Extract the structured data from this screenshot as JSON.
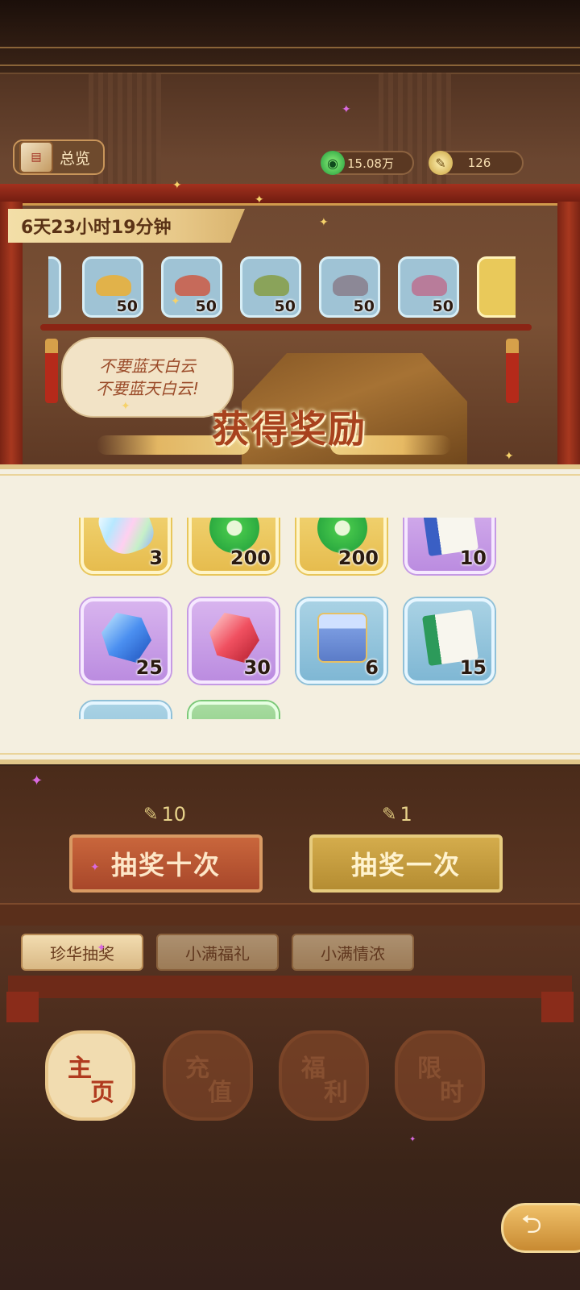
{
  "header": {
    "overview_label": "总览",
    "overview_icon": "book-icon",
    "currency_jade": "15.08万",
    "currency_feather": "126"
  },
  "event": {
    "timer": "6天23小时19分钟",
    "speech_line1": "不要蓝天白云",
    "speech_line2": "不要蓝天白云!"
  },
  "top_items": [
    {
      "qty": "50",
      "color": "#e1b24a"
    },
    {
      "qty": "50",
      "color": "#c66a5a"
    },
    {
      "qty": "50",
      "color": "#8aa35a"
    },
    {
      "qty": "50",
      "color": "#8c8896"
    },
    {
      "qty": "50",
      "color": "#b87c9a"
    }
  ],
  "reward_dialog": {
    "title": "获得奖励",
    "rewards": [
      {
        "qty": "3",
        "rarity": "gold",
        "icon": "rainbow-gem-icon"
      },
      {
        "qty": "200",
        "rarity": "gold",
        "icon": "jade-disc-icon"
      },
      {
        "qty": "200",
        "rarity": "gold",
        "icon": "jade-disc-icon"
      },
      {
        "qty": "10",
        "rarity": "purple",
        "icon": "scroll-book-icon"
      },
      {
        "qty": "25",
        "rarity": "purple",
        "icon": "blue-crystal-icon"
      },
      {
        "qty": "30",
        "rarity": "purple",
        "icon": "red-crystal-icon"
      },
      {
        "qty": "6",
        "rarity": "blue",
        "icon": "treasure-chest-icon"
      },
      {
        "qty": "15",
        "rarity": "blue",
        "icon": "scroll-book-icon"
      }
    ]
  },
  "draw": {
    "ten_cost": "10",
    "ten_label": "抽奖十次",
    "one_cost": "1",
    "one_label": "抽奖一次"
  },
  "tabs": [
    "珍华抽奖",
    "小满福礼",
    "小满情浓"
  ],
  "nav": [
    {
      "c1": "主",
      "c2": "页"
    },
    {
      "c1": "充",
      "c2": "值"
    },
    {
      "c1": "福",
      "c2": "利"
    },
    {
      "c1": "限",
      "c2": "时"
    }
  ],
  "colors": {
    "accent": "#a8421e",
    "panel": "#f4efe0"
  }
}
